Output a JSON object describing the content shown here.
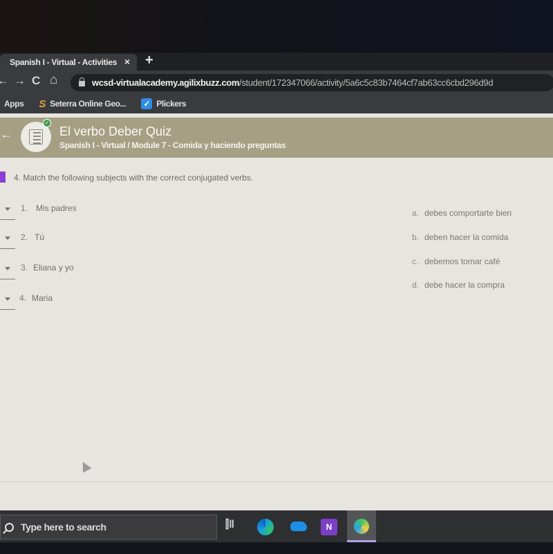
{
  "browser": {
    "tab_title": "Spanish I - Virtual - Activities",
    "tab_close": "×",
    "new_tab": "+",
    "nav": {
      "back": "←",
      "forward": "→",
      "reload": "C",
      "home": "⌂"
    },
    "url_host": "wcsd-virtualacademy.agilixbuzz.com",
    "url_path": "/student/172347066/activity/5a6c5c83b7464cf7ab63cc6cbd296d9d",
    "bookmarks": [
      {
        "label": "Apps",
        "icon": "apps-grid-icon"
      },
      {
        "label": "Seterra Online Geo...",
        "icon": "seterra-icon",
        "glyph": "S"
      },
      {
        "label": "Plickers",
        "icon": "plickers-check-icon",
        "glyph": "✓"
      }
    ]
  },
  "header": {
    "back": "←",
    "title": "El verbo Deber Quiz",
    "subtitle": "Spanish I - Virtual / Module 7 - Comida y haciendo preguntas",
    "badge": "✓",
    "accent": "#a59f84"
  },
  "question": {
    "text": "4. Match the following subjects with the correct conjugated verbs.",
    "marker_color": "#8a3fd6",
    "left_items": [
      {
        "num": "1.",
        "text": "Mis padres"
      },
      {
        "num": "2.",
        "text": "Tú"
      },
      {
        "num": "3.",
        "text": "Eliana y yo"
      },
      {
        "num": "4.",
        "text": "Maria"
      }
    ],
    "right_items": [
      {
        "letter": "a.",
        "text": "debes comportarte bien"
      },
      {
        "letter": "b.",
        "text": "deben hacer la comida"
      },
      {
        "letter": "c.",
        "text": "debemos tomar café"
      },
      {
        "letter": "d.",
        "text": "debe hacer la compra"
      }
    ]
  },
  "taskbar": {
    "search_placeholder": "Type here to search",
    "task_view": "⫿‖",
    "onenote": "N"
  }
}
